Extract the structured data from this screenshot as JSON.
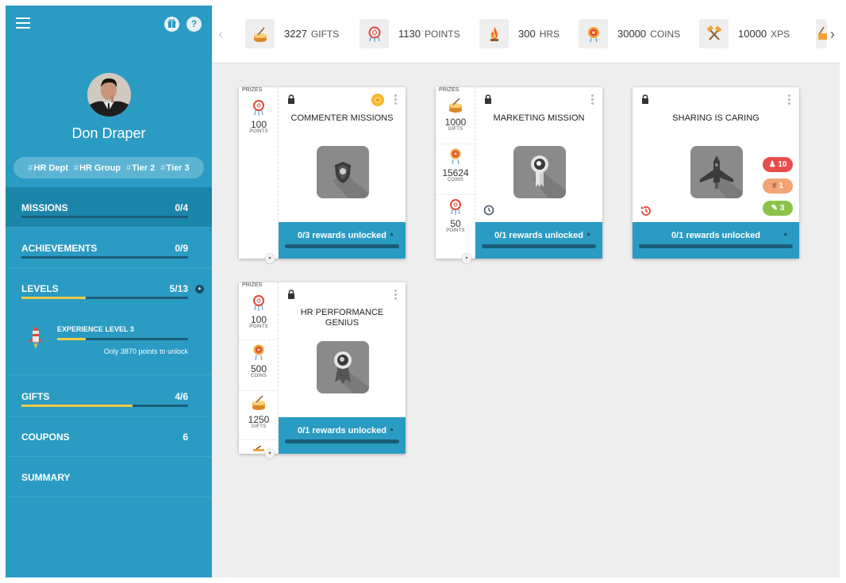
{
  "user": {
    "name": "Don Draper",
    "tags": [
      "HR Dept",
      "HR Group",
      "Tier 2",
      "Tier 3"
    ]
  },
  "sidebar": {
    "top_icons": [
      "gift-icon",
      "help-icon"
    ],
    "help_glyph": "?",
    "items": [
      {
        "label": "MISSIONS",
        "count": "0/4",
        "progress": 0
      },
      {
        "label": "ACHIEVEMENTS",
        "count": "0/9",
        "progress": 0
      },
      {
        "label": "LEVELS",
        "count": "5/13",
        "progress": 0.385
      },
      {
        "label": "GIFTS",
        "count": "4/6",
        "progress": 0.667
      },
      {
        "label": "COUPONS",
        "count": "6"
      },
      {
        "label": "SUMMARY",
        "count": ""
      }
    ],
    "level_detail": {
      "title": "EXPERIENCE LEVEL 3",
      "subtitle": "Only 3870 points to unlock",
      "progress": 0.22
    }
  },
  "topbar": {
    "stats": [
      {
        "value": "3227",
        "unit": "GIFTS",
        "icon": "gift-drum-icon"
      },
      {
        "value": "1130",
        "unit": "POINTS",
        "icon": "dreamcatcher-icon"
      },
      {
        "value": "300",
        "unit": "HRS",
        "icon": "flame-icon"
      },
      {
        "value": "30000",
        "unit": "COINS",
        "icon": "coin-icon"
      },
      {
        "value": "10000",
        "unit": "XPS",
        "icon": "hammers-icon"
      }
    ]
  },
  "cards": [
    {
      "title": "COMMENTER MISSIONS",
      "prize_header": "PRIZES",
      "prizes": [
        {
          "value": "100",
          "unit": "POINTS"
        }
      ],
      "footer": "0/3 rewards unlocked",
      "image_icon": "shield-icon"
    },
    {
      "title": "MARKETING MISSION",
      "prize_header": "PRIZES",
      "prizes": [
        {
          "value": "1000",
          "unit": "GIFTS"
        },
        {
          "value": "15624",
          "unit": "COINS"
        },
        {
          "value": "50",
          "unit": "POINTS"
        }
      ],
      "footer": "0/1 rewards unlocked",
      "image_icon": "ribbon-icon"
    },
    {
      "title": "SHARING IS CARING",
      "footer": "0/1 rewards unlocked",
      "image_icon": "rocket-icon",
      "badges": [
        {
          "value": "10",
          "color": "#e84c4c",
          "icon": "user-icon"
        },
        {
          "value": "1",
          "color": "#f2a477",
          "icon": "hash-icon"
        },
        {
          "value": "3",
          "color": "#8bc34a",
          "icon": "unlock-icon"
        }
      ]
    },
    {
      "title": "HR PERFORMANCE GENIUS",
      "prize_header": "PRIZES",
      "prizes": [
        {
          "value": "100",
          "unit": "POINTS"
        },
        {
          "value": "500",
          "unit": "COINS"
        },
        {
          "value": "1250",
          "unit": "GIFTS"
        }
      ],
      "footer": "0/1 rewards unlocked",
      "image_icon": "medal-icon"
    }
  ],
  "colors": {
    "sidebar": "#2a9bc2",
    "active": "#1c86aa",
    "progress": "#f2c94c",
    "background": "#eeeeee"
  }
}
